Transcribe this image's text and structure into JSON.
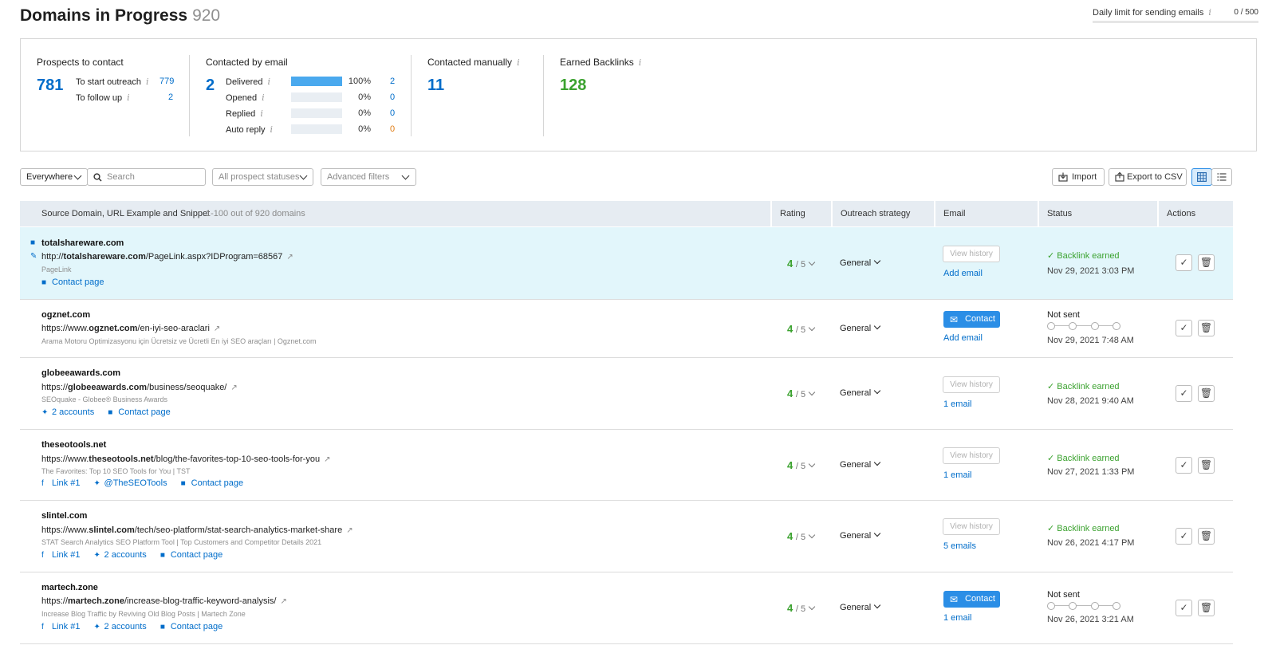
{
  "header": {
    "title": "Domains in Progress",
    "count": "920",
    "daily_limit_label": "Daily limit for sending emails",
    "daily_limit_value": "0 / 500",
    "daily_limit_fraction": 0
  },
  "stats": {
    "prospects": {
      "title": "Prospects to contact",
      "total": "781",
      "to_start_label": "To start outreach",
      "to_start_value": "779",
      "to_follow_label": "To follow up",
      "to_follow_value": "2"
    },
    "email": {
      "title": "Contacted by email",
      "total": "2",
      "rows": [
        {
          "label": "Delivered",
          "pct": "100%",
          "value": "2",
          "fraction": 1.0
        },
        {
          "label": "Opened",
          "pct": "0%",
          "value": "0",
          "fraction": 0
        },
        {
          "label": "Replied",
          "pct": "0%",
          "value": "0",
          "fraction": 0
        },
        {
          "label": "Auto reply",
          "pct": "0%",
          "value": "0",
          "fraction": 0
        }
      ]
    },
    "manual": {
      "title": "Contacted manually",
      "total": "11"
    },
    "backlinks": {
      "title": "Earned Backlinks",
      "total": "128"
    }
  },
  "toolbar": {
    "scope": "Everywhere",
    "search_placeholder": "Search",
    "status_filter": "All prospect statuses",
    "advanced_filters": "Advanced filters",
    "import_label": "Import",
    "export_label": "Export to CSV"
  },
  "table": {
    "col_source": "Source Domain, URL Example and Snippet",
    "range": "1-100 out of 920 domains",
    "col_rating": "Rating",
    "col_strategy": "Outreach strategy",
    "col_email": "Email",
    "col_status": "Status",
    "col_actions": "Actions",
    "rows": [
      {
        "domain": "totalshareware.com",
        "url_pre": "http://",
        "url_bold": "totalshareware.com",
        "url_post": "/PageLink.aspx?IDProgram=68567",
        "snippet": "PageLink",
        "link_contact": "Contact page",
        "rating": "4",
        "rating_max": "/ 5",
        "strategy": "General",
        "email_button": "View history",
        "email_link": "Add email",
        "status": "Backlink earned",
        "date": "Nov 29, 2021 3:03 PM"
      },
      {
        "domain": "ogznet.com",
        "url_pre": "https://www.",
        "url_bold": "ogznet.com",
        "url_post": "/en-iyi-seo-araclari",
        "snippet": "Arama Motoru Optimizasyonu için Ücretsiz ve Ücretli En iyi SEO araçları | Ogznet.com",
        "rating": "4",
        "rating_max": "/ 5",
        "strategy": "General",
        "email_button": "Contact",
        "email_link": "Add email",
        "status": "Not sent",
        "date": "Nov 29, 2021 7:48 AM"
      },
      {
        "domain": "globeeawards.com",
        "url_pre": "https://",
        "url_bold": "globeeawards.com",
        "url_post": "/business/seoquake/",
        "snippet": "SEOquake - Globee® Business Awards",
        "link_twitter": "2 accounts",
        "link_contact": "Contact page",
        "rating": "4",
        "rating_max": "/ 5",
        "strategy": "General",
        "email_button": "View history",
        "email_link": "1 email",
        "status": "Backlink earned",
        "date": "Nov 28, 2021 9:40 AM"
      },
      {
        "domain": "theseotools.net",
        "url_pre": "https://www.",
        "url_bold": "theseotools.net",
        "url_post": "/blog/the-favorites-top-10-seo-tools-for-you",
        "snippet": "The Favorites: Top 10 SEO Tools for You | TST",
        "link_facebook": "Link #1",
        "link_twitter": "@TheSEOTools",
        "link_contact": "Contact page",
        "rating": "4",
        "rating_max": "/ 5",
        "strategy": "General",
        "email_button": "View history",
        "email_link": "1 email",
        "status": "Backlink earned",
        "date": "Nov 27, 2021 1:33 PM"
      },
      {
        "domain": "slintel.com",
        "url_pre": "https://www.",
        "url_bold": "slintel.com",
        "url_post": "/tech/seo-platform/stat-search-analytics-market-share",
        "snippet": "STAT Search Analytics SEO Platform Tool | Top Customers and Competitor Details 2021",
        "link_facebook": "Link #1",
        "link_twitter": "2 accounts",
        "link_contact": "Contact page",
        "rating": "4",
        "rating_max": "/ 5",
        "strategy": "General",
        "email_button": "View history",
        "email_link": "5 emails",
        "status": "Backlink earned",
        "date": "Nov 26, 2021 4:17 PM"
      },
      {
        "domain": "martech.zone",
        "url_pre": "https://",
        "url_bold": "martech.zone",
        "url_post": "/increase-blog-traffic-keyword-analysis/",
        "snippet": "Increase Blog Traffic by Reviving Old Blog Posts | Martech Zone",
        "link_facebook": "Link #1",
        "link_twitter": "2 accounts",
        "link_contact": "Contact page",
        "rating": "4",
        "rating_max": "/ 5",
        "strategy": "General",
        "email_button": "Contact",
        "email_link": "1 email",
        "status": "Not sent",
        "date": "Nov 26, 2021 3:21 AM"
      }
    ]
  },
  "colors": {
    "accent_blue": "#006dca",
    "success_green": "#3ba22f",
    "button_blue": "#2b8ee6",
    "highlight_row": "#e2f6fb",
    "header_bg": "#e6ecf2"
  }
}
